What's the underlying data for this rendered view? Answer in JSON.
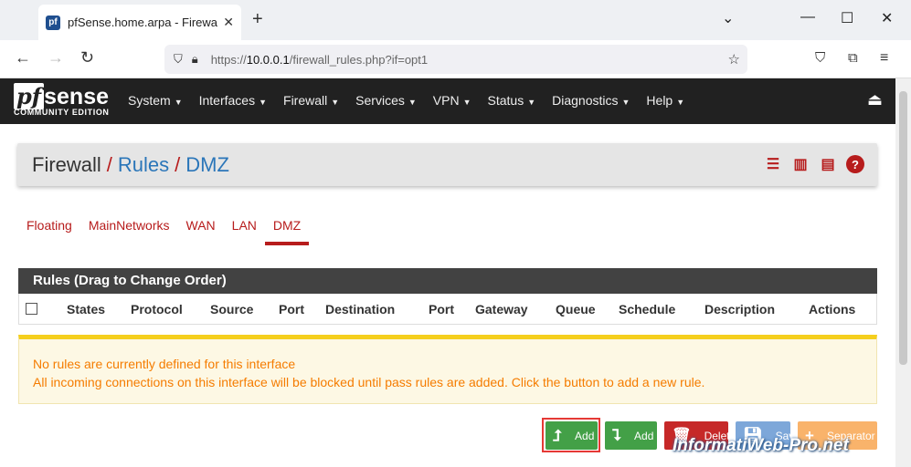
{
  "browser": {
    "tab_title": "pfSense.home.arpa - Firewall: R",
    "url_prefix": "https://",
    "url_host": "10.0.0.1",
    "url_path": "/firewall_rules.php?if=opt1"
  },
  "header": {
    "logo_pf": "pf",
    "logo_sense": "sense",
    "edition": "COMMUNITY EDITION",
    "menu": [
      "System",
      "Interfaces",
      "Firewall",
      "Services",
      "VPN",
      "Status",
      "Diagnostics",
      "Help"
    ]
  },
  "breadcrumb": {
    "root": "Firewall",
    "section": "Rules",
    "current": "DMZ"
  },
  "tabs": [
    "Floating",
    "MainNetworks",
    "WAN",
    "LAN",
    "DMZ"
  ],
  "active_tab": "DMZ",
  "panel": {
    "title": "Rules (Drag to Change Order)",
    "columns": [
      "States",
      "Protocol",
      "Source",
      "Port",
      "Destination",
      "Port",
      "Gateway",
      "Queue",
      "Schedule",
      "Description",
      "Actions"
    ]
  },
  "alert": {
    "line1": "No rules are currently defined for this interface",
    "line2": "All incoming connections on this interface will be blocked until pass rules are added. Click the button to add a new rule."
  },
  "buttons": {
    "add_top": "Add",
    "add_bottom": "Add",
    "delete": "Delete",
    "save": "Save",
    "separator": "Separator"
  },
  "watermark": "InformatiWeb-Pro.net",
  "colors": {
    "accent": "#b71c1c",
    "link": "#2b76b9",
    "header_bg": "#212121",
    "warning_text": "#f57c00"
  }
}
